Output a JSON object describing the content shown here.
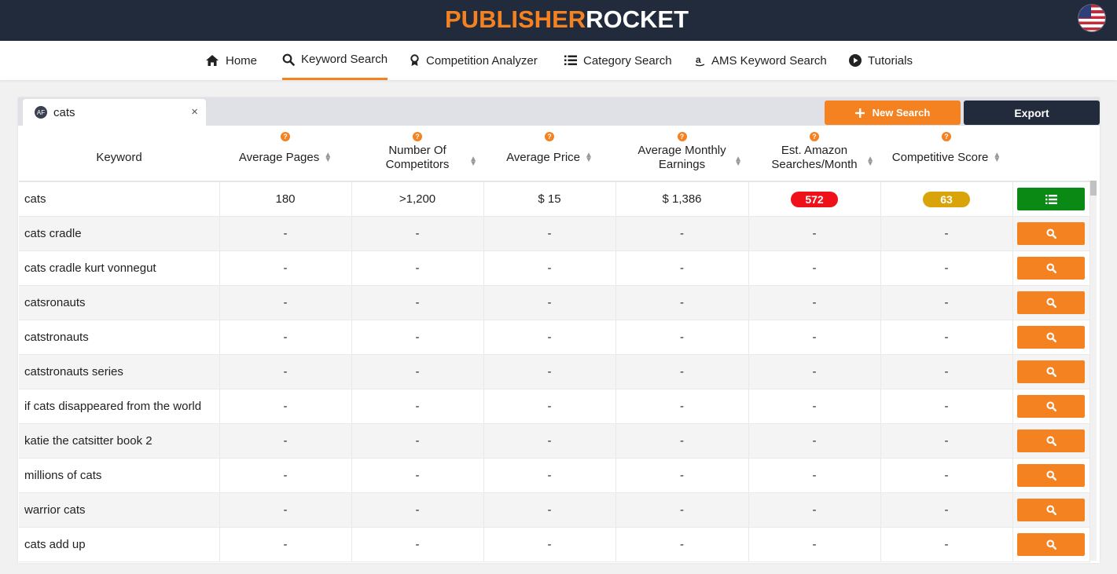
{
  "header": {
    "logo_part1": "PUBLISHER",
    "logo_part2": "ROCKET",
    "flag_icon": "us-flag-icon"
  },
  "nav": [
    {
      "label": "Home",
      "icon": "home-icon"
    },
    {
      "label": "Keyword Search",
      "icon": "search-icon",
      "active": true
    },
    {
      "label": "Competition Analyzer",
      "icon": "award-icon"
    },
    {
      "label": "Category Search",
      "icon": "list-icon"
    },
    {
      "label": "AMS Keyword Search",
      "icon": "amazon-icon"
    },
    {
      "label": "Tutorials",
      "icon": "play-icon"
    }
  ],
  "tab": {
    "badge": "AF",
    "label": "cats",
    "close": "×"
  },
  "toolbar": {
    "new_search": "New Search",
    "export": "Export"
  },
  "table": {
    "columns": [
      "Keyword",
      "Average Pages",
      "Number Of Competitors",
      "Average Price",
      "Average Monthly Earnings",
      "Est. Amazon Searches/Month",
      "Competitive Score"
    ],
    "column_lines": [
      [
        "Keyword"
      ],
      [
        "Average Pages"
      ],
      [
        "Number Of",
        "Competitors"
      ],
      [
        "Average Price"
      ],
      [
        "Average Monthly",
        "Earnings"
      ],
      [
        "Est. Amazon",
        "Searches/Month"
      ],
      [
        "Competitive Score"
      ]
    ],
    "rows": [
      {
        "keyword": "cats",
        "pages": "180",
        "competitors": ">1,200",
        "price": "$ 15",
        "earnings": "$ 1,386",
        "searches": "572",
        "score": "63",
        "analyzed": true
      },
      {
        "keyword": "cats cradle",
        "pages": "-",
        "competitors": "-",
        "price": "-",
        "earnings": "-",
        "searches": "-",
        "score": "-"
      },
      {
        "keyword": "cats cradle kurt vonnegut",
        "pages": "-",
        "competitors": "-",
        "price": "-",
        "earnings": "-",
        "searches": "-",
        "score": "-"
      },
      {
        "keyword": "catsronauts",
        "pages": "-",
        "competitors": "-",
        "price": "-",
        "earnings": "-",
        "searches": "-",
        "score": "-"
      },
      {
        "keyword": "catstronauts",
        "pages": "-",
        "competitors": "-",
        "price": "-",
        "earnings": "-",
        "searches": "-",
        "score": "-"
      },
      {
        "keyword": "catstronauts series",
        "pages": "-",
        "competitors": "-",
        "price": "-",
        "earnings": "-",
        "searches": "-",
        "score": "-"
      },
      {
        "keyword": "if cats disappeared from the world",
        "pages": "-",
        "competitors": "-",
        "price": "-",
        "earnings": "-",
        "searches": "-",
        "score": "-"
      },
      {
        "keyword": "katie the catsitter book 2",
        "pages": "-",
        "competitors": "-",
        "price": "-",
        "earnings": "-",
        "searches": "-",
        "score": "-"
      },
      {
        "keyword": "millions of cats",
        "pages": "-",
        "competitors": "-",
        "price": "-",
        "earnings": "-",
        "searches": "-",
        "score": "-"
      },
      {
        "keyword": "warrior cats",
        "pages": "-",
        "competitors": "-",
        "price": "-",
        "earnings": "-",
        "searches": "-",
        "score": "-"
      },
      {
        "keyword": "cats add up",
        "pages": "-",
        "competitors": "-",
        "price": "-",
        "earnings": "-",
        "searches": "-",
        "score": "-"
      }
    ]
  },
  "colors": {
    "brand_orange": "#f58220",
    "navy": "#222b3b",
    "searches_pill": "#f0101a",
    "score_pill": "#d9a40a",
    "analyzed_button": "#0a8a14"
  }
}
